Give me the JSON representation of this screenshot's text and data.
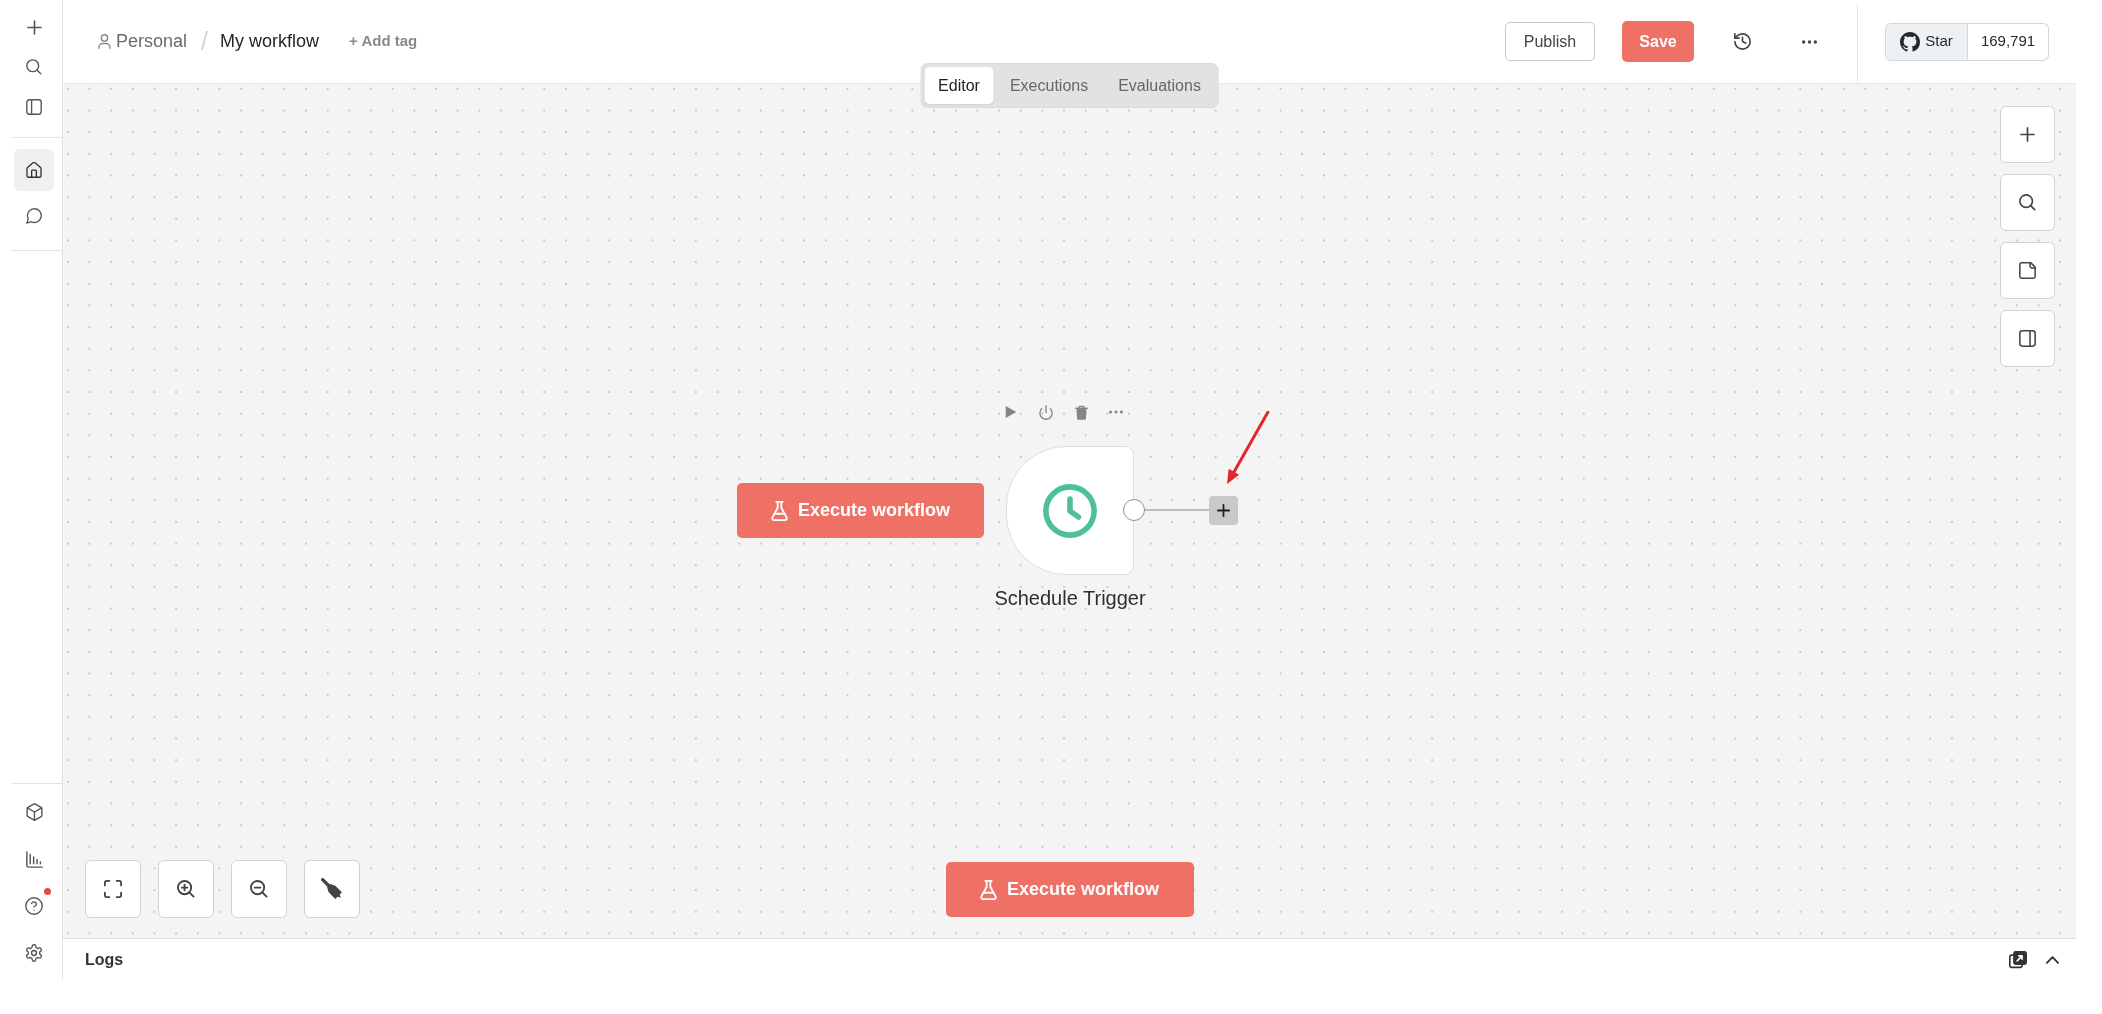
{
  "sidebar": {
    "top": [
      {
        "kind": "add",
        "selected": false
      },
      {
        "kind": "search",
        "selected": false
      },
      {
        "kind": "panel",
        "selected": false
      }
    ],
    "nav": [
      {
        "kind": "home",
        "selected": true
      },
      {
        "kind": "chat",
        "selected": false
      }
    ],
    "bottom": [
      {
        "kind": "templates",
        "selected": false,
        "notification": false
      },
      {
        "kind": "insights",
        "selected": false,
        "notification": false
      },
      {
        "kind": "help",
        "selected": false,
        "notification": true
      },
      {
        "kind": "settings",
        "selected": false,
        "notification": false
      }
    ]
  },
  "header": {
    "breadcrumb": {
      "project": "Personal",
      "separator": "/",
      "workflow": "My workflow"
    },
    "add_tag": "+ Add tag",
    "publish_button": "Publish",
    "save_button": "Save",
    "icon_buttons": [
      {
        "kind": "history"
      },
      {
        "kind": "more"
      }
    ],
    "github": {
      "label": "Star",
      "count": "169,791"
    }
  },
  "tabs": [
    {
      "label": "Editor",
      "selected": true
    },
    {
      "label": "Executions",
      "selected": false
    },
    {
      "label": "Evaluations",
      "selected": false
    }
  ],
  "canvas": {
    "node_execute_button": "Execute workflow",
    "node": {
      "name": "Schedule Trigger",
      "kind": "schedule",
      "toolbar": [
        {
          "kind": "run"
        },
        {
          "kind": "deactivate"
        },
        {
          "kind": "delete"
        },
        {
          "kind": "more"
        }
      ]
    },
    "right_toolbar": [
      {
        "kind": "add"
      },
      {
        "kind": "search"
      },
      {
        "kind": "sticky"
      },
      {
        "kind": "panel"
      }
    ],
    "zoom_controls": [
      {
        "kind": "fit"
      },
      {
        "kind": "zoom_in"
      },
      {
        "kind": "zoom_out"
      },
      {
        "kind": "tidy"
      }
    ],
    "execute_button": "Execute workflow"
  },
  "logs": {
    "title": "Logs",
    "icons": [
      {
        "kind": "popout"
      },
      {
        "kind": "expand"
      }
    ]
  }
}
